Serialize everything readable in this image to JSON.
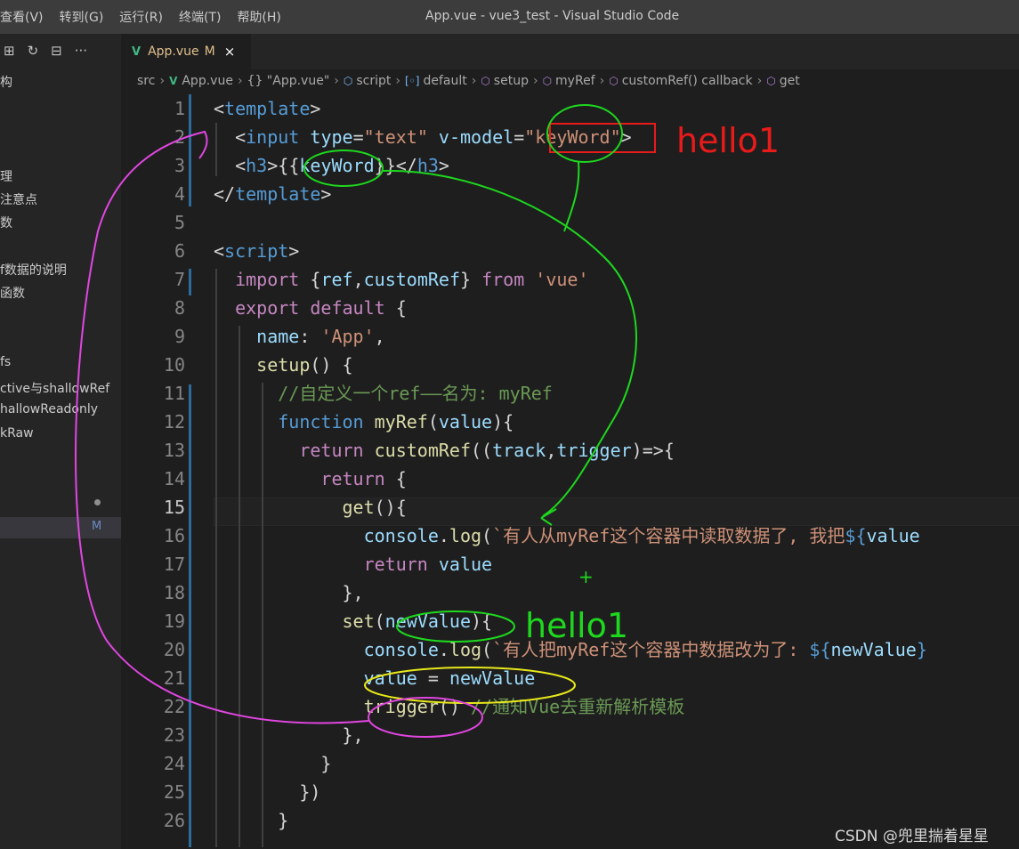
{
  "titlebar": {
    "menu": [
      "查看(V)",
      "转到(G)",
      "运行(R)",
      "终端(T)",
      "帮助(H)"
    ],
    "window_title": "App.vue - vue3_test - Visual Studio Code"
  },
  "sidebar": {
    "action_icons": [
      "new-folder-icon",
      "refresh-icon",
      "collapse-all-icon",
      "more-icon"
    ],
    "items": [
      "构",
      "",
      "",
      "",
      "理",
      "注意点",
      "数",
      "",
      "f数据的说明",
      "函数",
      "",
      "",
      "fs",
      "ctive与shallowRef",
      "hallowReadonly",
      "kRaw"
    ],
    "badge_m": "M"
  },
  "tab": {
    "label": "App.vue",
    "modified": "M",
    "close": "×"
  },
  "breadcrumb": {
    "parts": [
      "src",
      "App.vue",
      "{} \"App.vue\"",
      "script",
      "default",
      "setup",
      "myRef",
      "customRef() callback",
      "get"
    ]
  },
  "editor": {
    "active_line": 15,
    "lines": [
      {
        "n": "1"
      },
      {
        "n": "2"
      },
      {
        "n": "3"
      },
      {
        "n": "4"
      },
      {
        "n": "5"
      },
      {
        "n": "6"
      },
      {
        "n": "7"
      },
      {
        "n": "8"
      },
      {
        "n": "9"
      },
      {
        "n": "10"
      },
      {
        "n": "11"
      },
      {
        "n": "12"
      },
      {
        "n": "13"
      },
      {
        "n": "14"
      },
      {
        "n": "15"
      },
      {
        "n": "16"
      },
      {
        "n": "17"
      },
      {
        "n": "18"
      },
      {
        "n": "19"
      },
      {
        "n": "20"
      },
      {
        "n": "21"
      },
      {
        "n": "22"
      },
      {
        "n": "23"
      },
      {
        "n": "24"
      },
      {
        "n": "25"
      },
      {
        "n": "26"
      }
    ]
  },
  "annotations": {
    "red_text": "hello1",
    "green_text": "hello1",
    "plus": "+"
  },
  "watermark": "CSDN @兜里揣着星星"
}
